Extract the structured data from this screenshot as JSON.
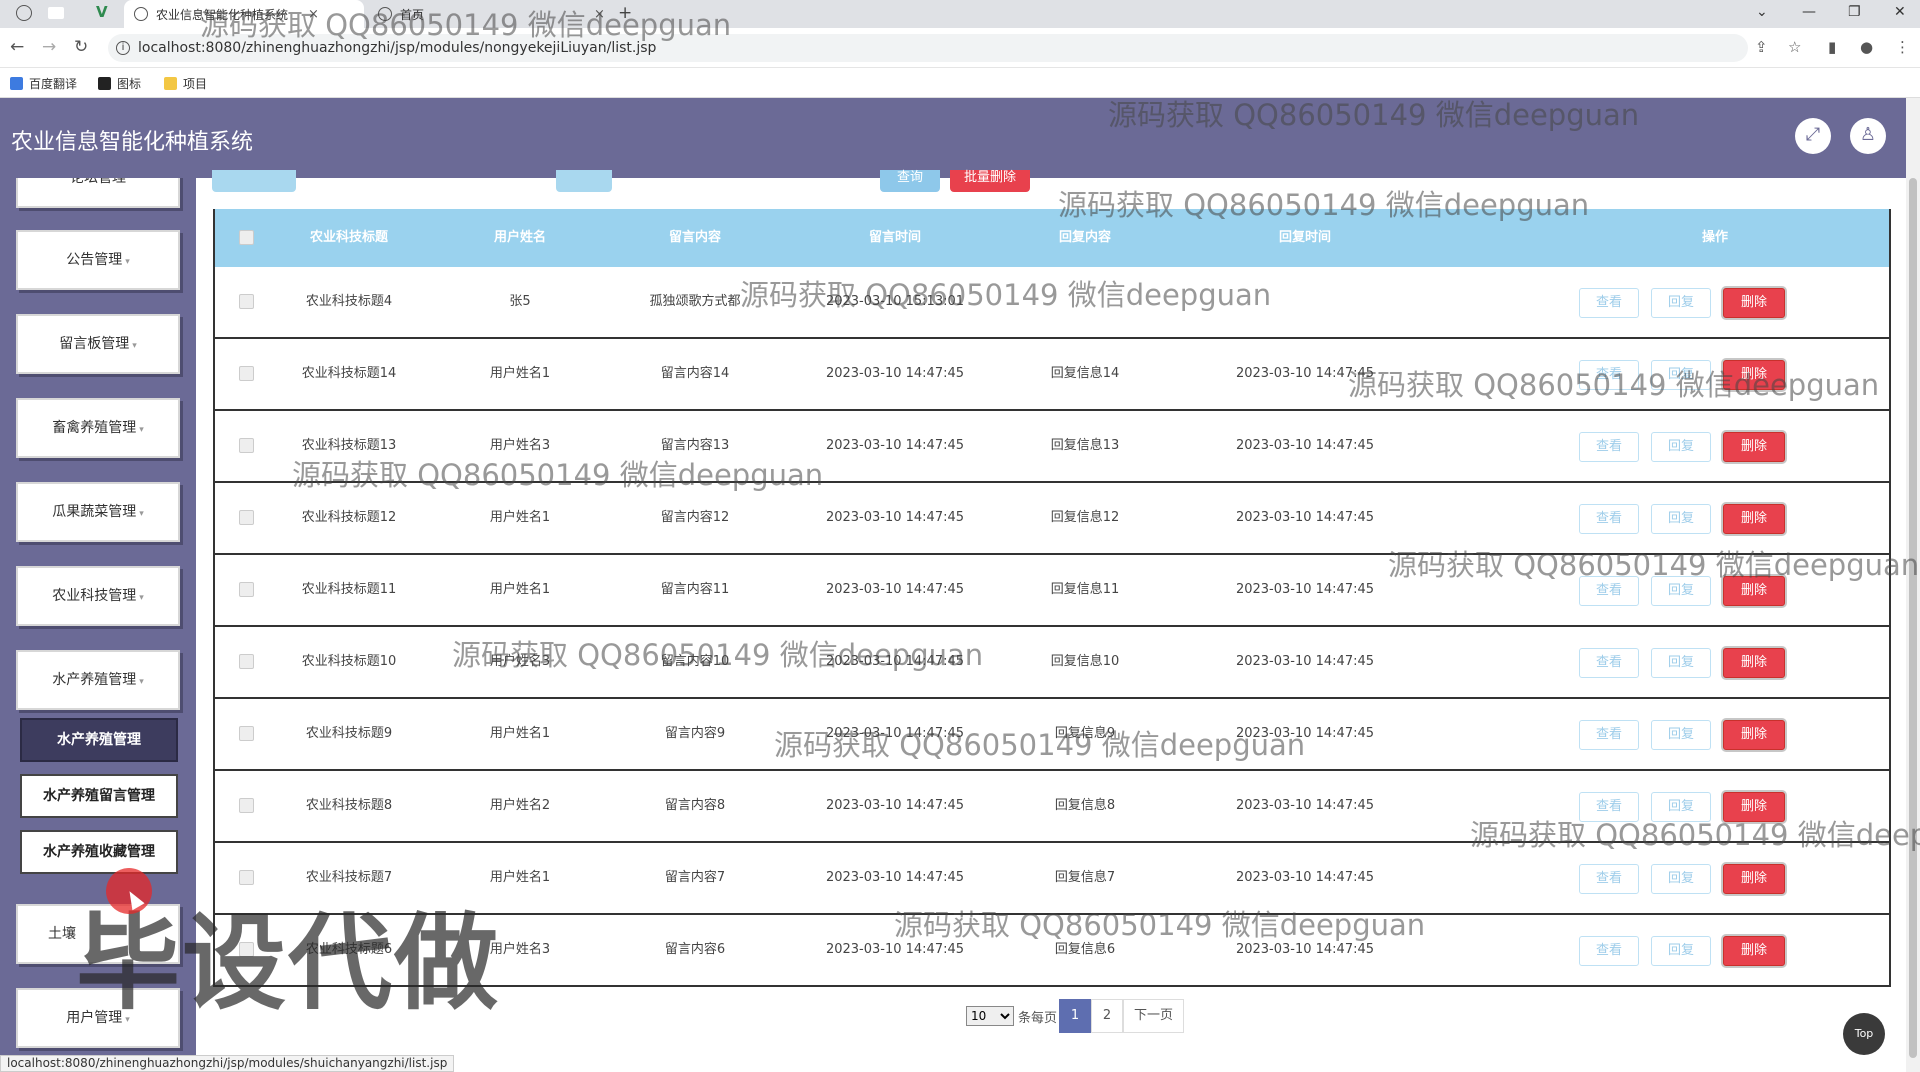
{
  "browser": {
    "tabs": [
      {
        "label": "农业信息智能化种植系统",
        "active": true
      },
      {
        "label": "首页",
        "active": false
      }
    ],
    "new_tab": "+",
    "url": "localhost:8080/zhinenghuazhongzhi/jsp/modules/nongyekejiLiuyan/list.jsp",
    "bookmarks": [
      "百度翻译",
      "图标",
      "项目"
    ],
    "status_url": "localhost:8080/zhinenghuazhongzhi/jsp/modules/shuichanyangzhi/list.jsp"
  },
  "header": {
    "title": "农业信息智能化种植系统"
  },
  "sidebar": {
    "items": [
      {
        "label": "论坛管理"
      },
      {
        "label": "公告管理"
      },
      {
        "label": "留言板管理"
      },
      {
        "label": "畜禽养殖管理"
      },
      {
        "label": "瓜果蔬菜管理"
      },
      {
        "label": "农业科技管理"
      },
      {
        "label": "水产养殖管理"
      }
    ],
    "submenu": [
      {
        "label": "水产养殖管理",
        "active": true
      },
      {
        "label": "水产养殖留言管理",
        "active": false
      },
      {
        "label": "水产养殖收藏管理",
        "active": false
      }
    ],
    "items_after": [
      {
        "label": "土壤"
      },
      {
        "label": "用户管理"
      }
    ],
    "caret": "▾"
  },
  "toolbar": {
    "search_label": "查询",
    "batch_delete_label": "批量删除"
  },
  "table": {
    "columns": [
      "农业科技标题",
      "用户姓名",
      "留言内容",
      "留言时间",
      "回复内容",
      "回复时间",
      "操作"
    ],
    "action_labels": {
      "view": "查看",
      "reply": "回复",
      "delete": "删除"
    },
    "rows": [
      {
        "title": "农业科技标题4",
        "user": "张5",
        "content": "孤独颂歌方式都",
        "time": "2023-03-10 15:13:01",
        "reply": "",
        "reply_time": ""
      },
      {
        "title": "农业科技标题14",
        "user": "用户姓名1",
        "content": "留言内容14",
        "time": "2023-03-10 14:47:45",
        "reply": "回复信息14",
        "reply_time": "2023-03-10 14:47:45"
      },
      {
        "title": "农业科技标题13",
        "user": "用户姓名3",
        "content": "留言内容13",
        "time": "2023-03-10 14:47:45",
        "reply": "回复信息13",
        "reply_time": "2023-03-10 14:47:45"
      },
      {
        "title": "农业科技标题12",
        "user": "用户姓名1",
        "content": "留言内容12",
        "time": "2023-03-10 14:47:45",
        "reply": "回复信息12",
        "reply_time": "2023-03-10 14:47:45"
      },
      {
        "title": "农业科技标题11",
        "user": "用户姓名1",
        "content": "留言内容11",
        "time": "2023-03-10 14:47:45",
        "reply": "回复信息11",
        "reply_time": "2023-03-10 14:47:45"
      },
      {
        "title": "农业科技标题10",
        "user": "用户姓名3",
        "content": "留言内容10",
        "time": "2023-03-10 14:47:45",
        "reply": "回复信息10",
        "reply_time": "2023-03-10 14:47:45"
      },
      {
        "title": "农业科技标题9",
        "user": "用户姓名1",
        "content": "留言内容9",
        "time": "2023-03-10 14:47:45",
        "reply": "回复信息9",
        "reply_time": "2023-03-10 14:47:45"
      },
      {
        "title": "农业科技标题8",
        "user": "用户姓名2",
        "content": "留言内容8",
        "time": "2023-03-10 14:47:45",
        "reply": "回复信息8",
        "reply_time": "2023-03-10 14:47:45"
      },
      {
        "title": "农业科技标题7",
        "user": "用户姓名1",
        "content": "留言内容7",
        "time": "2023-03-10 14:47:45",
        "reply": "回复信息7",
        "reply_time": "2023-03-10 14:47:45"
      },
      {
        "title": "农业科技标题6",
        "user": "用户姓名3",
        "content": "留言内容6",
        "time": "2023-03-10 14:47:45",
        "reply": "回复信息6",
        "reply_time": "2023-03-10 14:47:45"
      }
    ]
  },
  "pagination": {
    "page_size": "10",
    "page_size_options": [
      "10"
    ],
    "per_page_label": "条每页",
    "pages": [
      "1",
      "2"
    ],
    "current_page": "1",
    "next_label": "下一页"
  },
  "top_button": "Top",
  "watermark": {
    "text": "源码获取 QQ86050149 微信deepguan",
    "tab_text": "源码获取 QQ86050149 微信deepguan",
    "big": "毕设代做"
  },
  "colors": {
    "header_bg": "#6b6a96",
    "table_head": "#9ad2ee",
    "delete_btn": "#e8414d",
    "page_active": "#5e6eb0"
  }
}
